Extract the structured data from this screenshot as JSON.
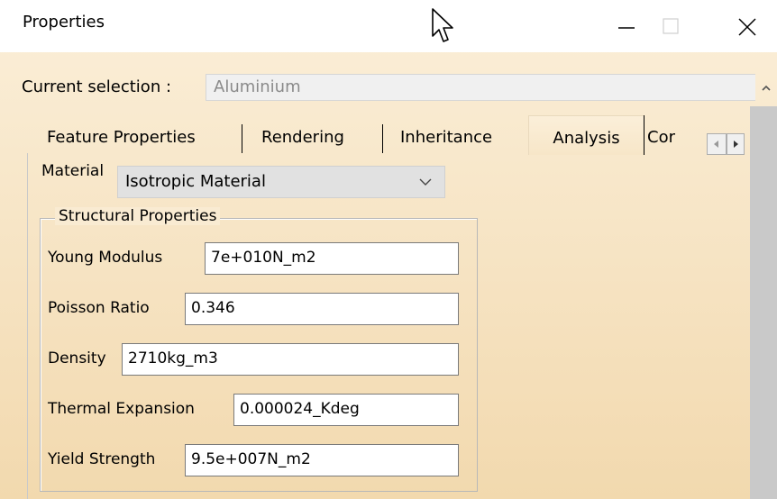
{
  "window": {
    "title": "Properties"
  },
  "selection": {
    "label": "Current selection :",
    "value": "Aluminium"
  },
  "tabs": [
    {
      "label": "Feature Properties",
      "active": false
    },
    {
      "label": "Rendering",
      "active": false
    },
    {
      "label": "Inheritance",
      "active": false
    },
    {
      "label": "Analysis",
      "active": true
    },
    {
      "label": "Cor",
      "active": false
    }
  ],
  "analysis": {
    "material_label": "Material",
    "material_value": "Isotropic Material",
    "group_title": "Structural Properties",
    "properties": [
      {
        "label": "Young Modulus",
        "value": "7e+010N_m2"
      },
      {
        "label": "Poisson Ratio",
        "value": "0.346"
      },
      {
        "label": "Density",
        "value": "2710kg_m3"
      },
      {
        "label": "Thermal Expansion",
        "value": "0.000024_Kdeg"
      },
      {
        "label": "Yield Strength",
        "value": "9.5e+007N_m2"
      }
    ]
  },
  "colors": {
    "background": "#f6e3c2",
    "scrollbar": "#c9c9c9",
    "disabled_text": "#8a8a8a"
  },
  "icons": [
    "mouse-cursor-icon",
    "minimize-icon",
    "maximize-icon",
    "close-icon",
    "scroll-up-icon",
    "chevron-down-icon",
    "tab-scroll-left-icon",
    "tab-scroll-right-icon"
  ]
}
